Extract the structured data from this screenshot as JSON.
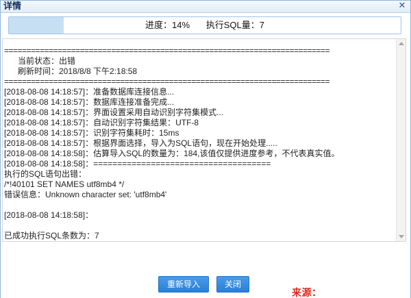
{
  "window": {
    "title": "详情",
    "close_icon": "close-icon"
  },
  "progress": {
    "fraction": 0.14,
    "label": "进度：14%",
    "sql_count": "执行SQL量：7",
    "fill_color": "#c7dff3"
  },
  "log": {
    "lines": [
      "=========================================================================",
      "      当前状态：出错",
      "      刷新时间：2018/8/8 下午2:18:58",
      "=========================================================================",
      "[2018-08-08 14:18:57]：准备数据库连接信息...",
      "[2018-08-08 14:18:57]：数据库连接准备完成...",
      "[2018-08-08 14:18:57]：界面设置采用自动识别字符集模式...",
      "[2018-08-08 14:18:57]：自动识别字符集结果：UTF-8",
      "[2018-08-08 14:18:57]：识别字符集耗时：15ms",
      "[2018-08-08 14:18:57]：根据界面选择，导入为SQL语句，现在开始处理.....",
      "[2018-08-08 14:18:58]：估算导入SQL的数量为：184,该值仅提供进度参考，不代表真实值。",
      "[2018-08-08 14:18:58]：=====================================",
      "执行的SQL语句出错：",
      "/*!40101 SET NAMES utf8mb4 */",
      "错误信息：Unknown character set: 'utf8mb4'",
      "",
      "[2018-08-08 14:18:58]：",
      "",
      "已成功执行SQL条数为：7"
    ]
  },
  "buttons": {
    "reimport": "重新导入",
    "close": "关闭"
  },
  "watermark": "来源：www.aiyiliu.com"
}
